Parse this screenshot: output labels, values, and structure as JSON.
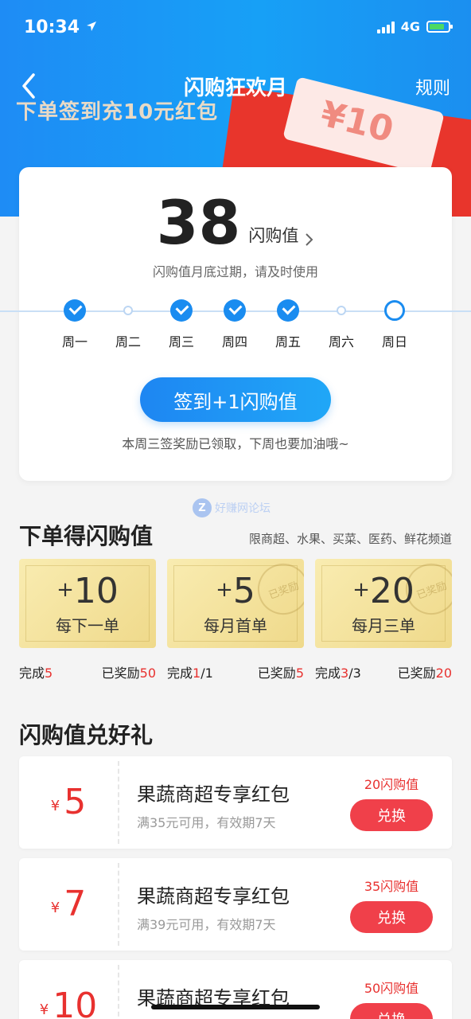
{
  "status_bar": {
    "time": "10:34",
    "network": "4G"
  },
  "navbar": {
    "title": "闪购狂欢月",
    "rules_label": "规则"
  },
  "banner": {
    "peek_text": "下单签到充10元红包",
    "ticket_text": "¥10"
  },
  "points": {
    "value": "38",
    "unit": "闪购值",
    "expire_note": "闪购值月底过期，请及时使用"
  },
  "week": [
    {
      "label": "周一",
      "state": "done"
    },
    {
      "label": "周二",
      "state": "missed"
    },
    {
      "label": "周三",
      "state": "done"
    },
    {
      "label": "周四",
      "state": "done"
    },
    {
      "label": "周五",
      "state": "done"
    },
    {
      "label": "周六",
      "state": "missed"
    },
    {
      "label": "周日",
      "state": "today"
    }
  ],
  "sign_in": {
    "button_label": "签到+1闪购值",
    "note": "本周三签奖励已领取，下周也要加油哦~"
  },
  "watermark": {
    "icon_text": "Z",
    "text": "好赚网论坛"
  },
  "order_section": {
    "title": "下单得闪购值",
    "subtitle": "限商超、水果、买菜、医药、鲜花频道",
    "tasks": [
      {
        "plus": "+",
        "value": "10",
        "name": "每下一单",
        "stamp": "",
        "done_label": "完成",
        "done_value": "5",
        "done_total": "",
        "reward_label": "已奖励",
        "reward_value": "50"
      },
      {
        "plus": "+",
        "value": "5",
        "name": "每月首单",
        "stamp": "已奖励",
        "done_label": "完成",
        "done_value": "1",
        "done_total": "/1",
        "reward_label": "已奖励",
        "reward_value": "5"
      },
      {
        "plus": "+",
        "value": "20",
        "name": "每月三单",
        "stamp": "已奖励",
        "done_label": "完成",
        "done_value": "3",
        "done_total": "/3",
        "reward_label": "已奖励",
        "reward_value": "20"
      }
    ]
  },
  "exchange_section": {
    "title": "闪购值兑好礼",
    "coupons": [
      {
        "currency": "¥",
        "amount": "5",
        "name": "果蔬商超专享红包",
        "desc": "满35元可用，有效期7天",
        "cost": "20闪购值",
        "button": "兑换"
      },
      {
        "currency": "¥",
        "amount": "7",
        "name": "果蔬商超专享红包",
        "desc": "满39元可用，有效期7天",
        "cost": "35闪购值",
        "button": "兑换"
      },
      {
        "currency": "¥",
        "amount": "10",
        "name": "果蔬商超专享红包",
        "desc": "",
        "cost": "50闪购值",
        "button": "兑换"
      }
    ]
  },
  "colors": {
    "primary_blue": "#1a8cf0",
    "accent_red": "#e8312f",
    "gold": "#efd98a"
  }
}
